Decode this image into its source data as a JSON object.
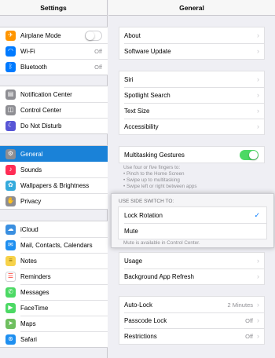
{
  "sidebar": {
    "title": "Settings",
    "group1": [
      {
        "label": "Airplane Mode",
        "icon": "airplane-icon",
        "color": "#ff9500",
        "glyph": "✈",
        "control": "toggle-off"
      },
      {
        "label": "Wi-Fi",
        "icon": "wifi-icon",
        "color": "#007aff",
        "glyph": "◠",
        "value": "Off"
      },
      {
        "label": "Bluetooth",
        "icon": "bluetooth-icon",
        "color": "#007aff",
        "glyph": "ᛒ",
        "value": "Off"
      }
    ],
    "group2": [
      {
        "label": "Notification Center",
        "icon": "notification-center-icon",
        "color": "#8e8e93",
        "glyph": "▤"
      },
      {
        "label": "Control Center",
        "icon": "control-center-icon",
        "color": "#8e8e93",
        "glyph": "◫"
      },
      {
        "label": "Do Not Disturb",
        "icon": "moon-icon",
        "color": "#5856d6",
        "glyph": "☾"
      }
    ],
    "group3": [
      {
        "label": "General",
        "icon": "gear-icon",
        "color": "#8e8e93",
        "glyph": "⚙",
        "selected": true
      },
      {
        "label": "Sounds",
        "icon": "sounds-icon",
        "color": "#ff2d55",
        "glyph": "♪"
      },
      {
        "label": "Wallpapers & Brightness",
        "icon": "wallpaper-icon",
        "color": "#34aadc",
        "glyph": "✿"
      },
      {
        "label": "Privacy",
        "icon": "privacy-hand-icon",
        "color": "#8e8e93",
        "glyph": "✋"
      }
    ],
    "group4": [
      {
        "label": "iCloud",
        "icon": "icloud-icon",
        "color": "#3a8fe0",
        "glyph": "☁"
      },
      {
        "label": "Mail, Contacts, Calendars",
        "icon": "mail-icon",
        "color": "#1e8ff0",
        "glyph": "✉"
      },
      {
        "label": "Notes",
        "icon": "notes-icon",
        "color": "#f7d24a",
        "glyph": "≡"
      },
      {
        "label": "Reminders",
        "icon": "reminders-icon",
        "color": "#ffffff",
        "glyph": "☰"
      },
      {
        "label": "Messages",
        "icon": "messages-icon",
        "color": "#4cd964",
        "glyph": "✆"
      },
      {
        "label": "FaceTime",
        "icon": "facetime-icon",
        "color": "#4cd964",
        "glyph": "▶"
      },
      {
        "label": "Maps",
        "icon": "maps-icon",
        "color": "#6fbf5f",
        "glyph": "➤"
      },
      {
        "label": "Safari",
        "icon": "safari-compass-icon",
        "color": "#1e8ff0",
        "glyph": "⊛"
      }
    ]
  },
  "main": {
    "title": "General",
    "group1": [
      {
        "label": "About"
      },
      {
        "label": "Software Update"
      }
    ],
    "group2": [
      {
        "label": "Siri"
      },
      {
        "label": "Spotlight Search"
      },
      {
        "label": "Text Size"
      },
      {
        "label": "Accessibility"
      }
    ],
    "multitasking": {
      "label": "Multitasking Gestures",
      "enabled": true,
      "footnote_lines": [
        "Use four or five fingers to:",
        "• Pinch to the Home Screen",
        "• Swipe up to multitasking",
        "• Swipe left or right between apps"
      ]
    },
    "side_switch": {
      "header": "USE SIDE SWITCH TO:",
      "options": [
        {
          "label": "Lock Rotation",
          "checked": true
        },
        {
          "label": "Mute",
          "checked": false
        }
      ],
      "footnote": "Mute is available in Control Center."
    },
    "group4": [
      {
        "label": "Usage"
      },
      {
        "label": "Background App Refresh"
      }
    ],
    "group5": [
      {
        "label": "Auto-Lock",
        "value": "2 Minutes"
      },
      {
        "label": "Passcode Lock",
        "value": "Off"
      },
      {
        "label": "Restrictions",
        "value": "Off"
      }
    ],
    "chevron": "›",
    "checkmark": "✓"
  },
  "colors": {
    "accent": "#007aff",
    "selected_row": "#1a82d8",
    "toggle_on": "#4cd964"
  }
}
